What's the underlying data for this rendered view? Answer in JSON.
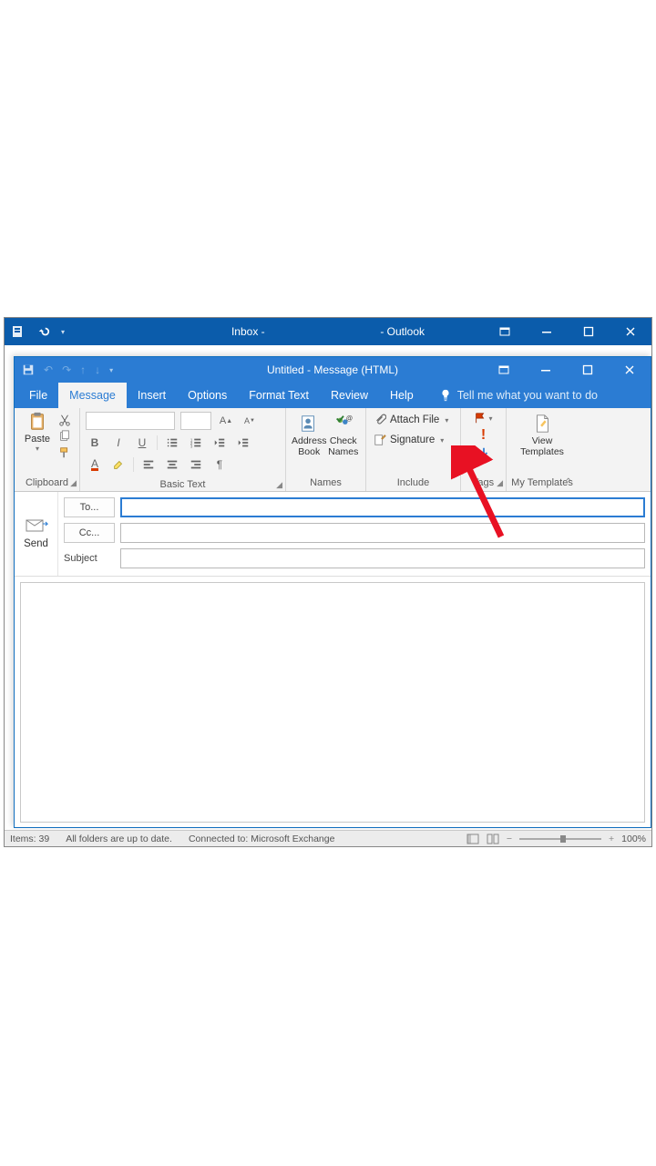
{
  "parentWindow": {
    "titleLeft": "Inbox -",
    "titleApp": "- Outlook"
  },
  "childWindow": {
    "title": "Untitled  -  Message (HTML)"
  },
  "tabs": {
    "file": "File",
    "message": "Message",
    "insert": "Insert",
    "options": "Options",
    "formatText": "Format Text",
    "review": "Review",
    "help": "Help",
    "tellMe": "Tell me what you want to do"
  },
  "ribbon": {
    "clipboard": {
      "paste": "Paste",
      "label": "Clipboard"
    },
    "basicText": {
      "bold": "B",
      "italic": "I",
      "underline": "U",
      "label": "Basic Text"
    },
    "names": {
      "addressBook": "Address Book",
      "checkNames": "Check Names",
      "label": "Names"
    },
    "include": {
      "attachFile": "Attach File",
      "signature": "Signature",
      "label": "Include"
    },
    "tags": {
      "label": "Tags"
    },
    "templates": {
      "viewTemplates": "View Templates",
      "label": "My Templates"
    }
  },
  "compose": {
    "send": "Send",
    "to": "To...",
    "cc": "Cc...",
    "subject": "Subject",
    "toValue": "",
    "ccValue": "",
    "subjectValue": ""
  },
  "statusbar": {
    "items": "Items: 39",
    "folders": "All folders are up to date.",
    "connected": "Connected to: Microsoft Exchange",
    "zoom": "100%"
  }
}
